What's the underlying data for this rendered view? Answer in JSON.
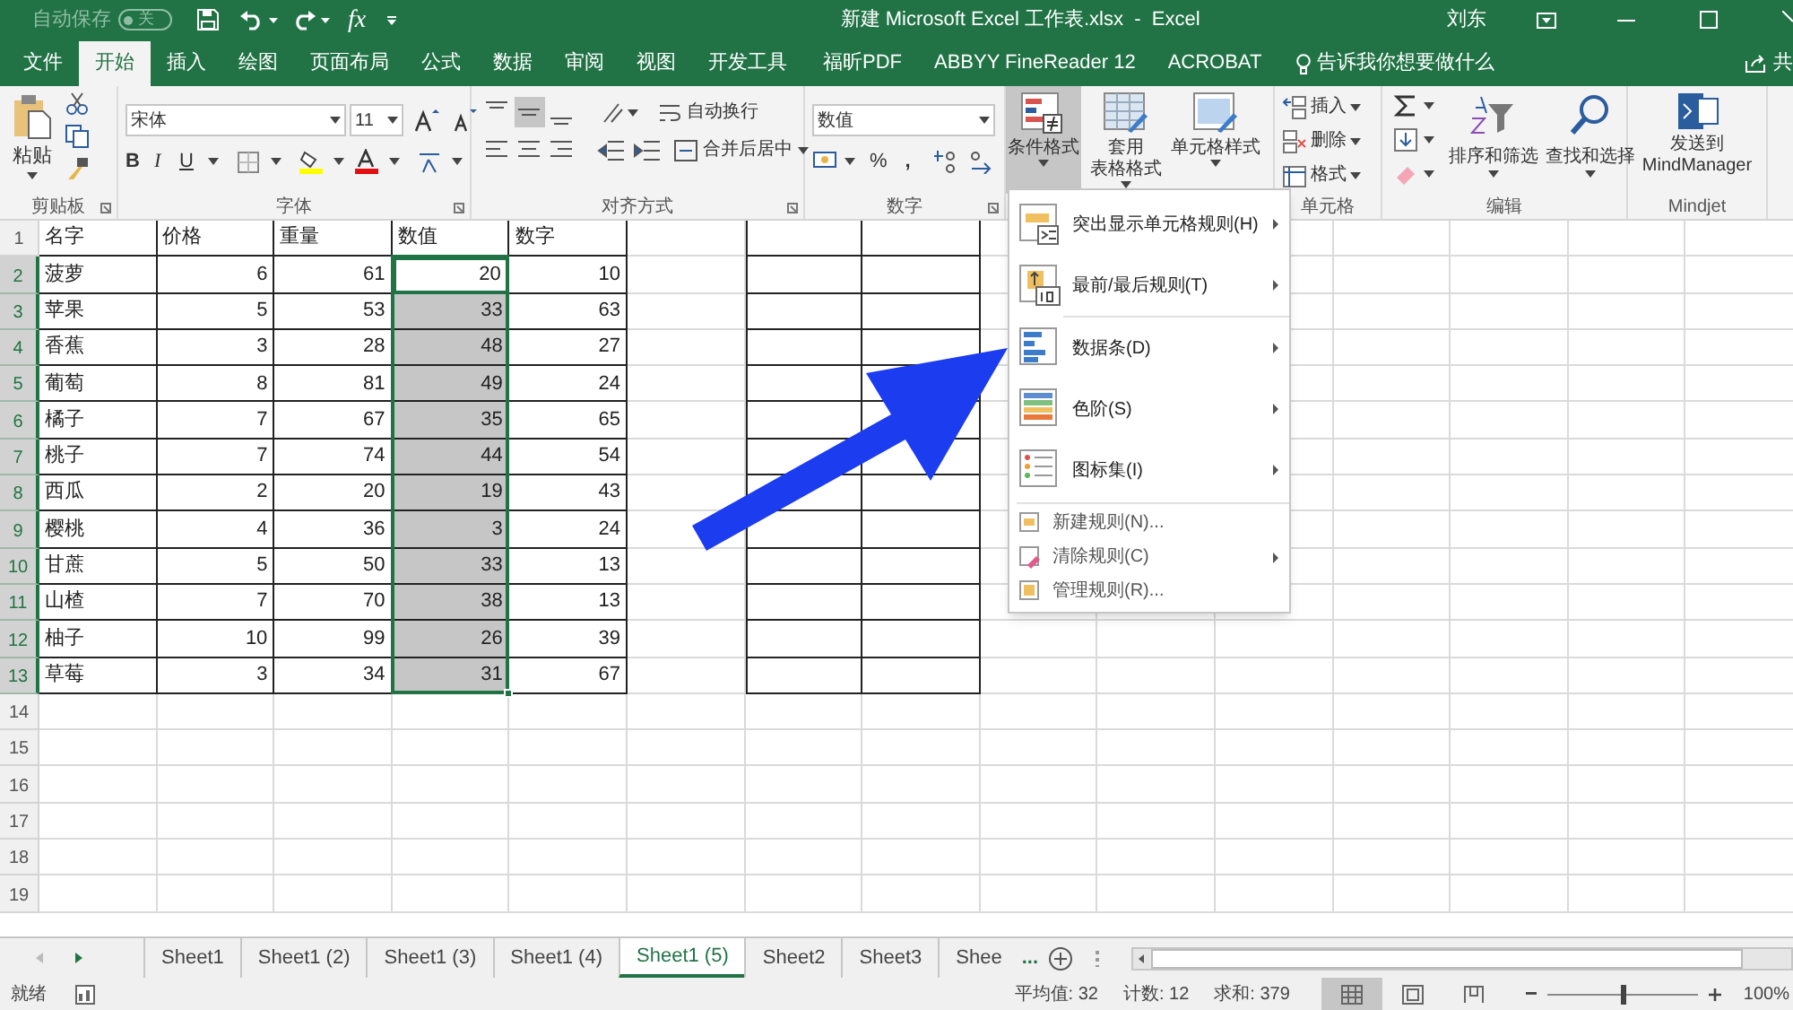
{
  "title_bar": {
    "autosave_label": "自动保存",
    "autosave_state": "关",
    "autosave_on": false,
    "formula_quick": "fx",
    "title": "新建 Microsoft Excel 工作表.xlsx  -  Excel",
    "user": "刘东"
  },
  "menu_tabs": [
    {
      "label": "文件",
      "selected": false
    },
    {
      "label": "开始",
      "selected": true
    },
    {
      "label": "插入",
      "selected": false
    },
    {
      "label": "绘图",
      "selected": false
    },
    {
      "label": "页面布局",
      "selected": false
    },
    {
      "label": "公式",
      "selected": false
    },
    {
      "label": "数据",
      "selected": false
    },
    {
      "label": "审阅",
      "selected": false
    },
    {
      "label": "视图",
      "selected": false
    },
    {
      "label": "开发工具",
      "selected": false
    },
    {
      "label": "福昕PDF",
      "selected": false
    },
    {
      "label": "ABBYY FineReader 12",
      "selected": false
    },
    {
      "label": "ACROBAT",
      "selected": false
    }
  ],
  "tell_me": "告诉我你想要做什么",
  "share": "共",
  "ribbon": {
    "clipboard": {
      "paste": "粘贴",
      "label": "剪贴板"
    },
    "font": {
      "name": "宋体",
      "size": "11",
      "bold": "B",
      "italic": "I",
      "underline": "U",
      "label": "字体"
    },
    "alignment": {
      "vertical_align": [
        {
          "selected": false
        },
        {
          "selected": true
        },
        {
          "selected": false
        }
      ],
      "wrap": "自动换行",
      "merge": "合并后居中",
      "label": "对齐方式"
    },
    "number": {
      "format": "数值",
      "percent": "%",
      "comma": ",",
      "label": "数字"
    },
    "styles": [
      {
        "lines": [
          "条件格式"
        ],
        "expanded": true
      },
      {
        "lines": [
          "套用",
          "表格格式"
        ],
        "expanded": false
      },
      {
        "lines": [
          "单元格样式"
        ],
        "expanded": false
      }
    ],
    "cells": {
      "insert": "插入",
      "delete": "删除",
      "format": "格式",
      "label": "单元格"
    },
    "editing": {
      "sort": "排序和筛选",
      "find": "查找和选择",
      "label": "编辑"
    },
    "mindjet": {
      "send": "发送到\nMindManager",
      "label": "Mindjet"
    }
  },
  "sheet": {
    "rows": [
      {
        "n": "1",
        "cells": [
          {
            "text": "名字",
            "selected": false,
            "active": false
          },
          {
            "text": "价格",
            "selected": false,
            "active": false
          },
          {
            "text": "重量",
            "selected": false,
            "active": false
          },
          {
            "text": "数值",
            "selected": false,
            "active": false
          },
          {
            "text": "数字",
            "selected": false,
            "active": false
          }
        ]
      },
      {
        "n": "2",
        "cells": [
          {
            "text": "菠萝",
            "selected": false,
            "active": false
          },
          {
            "text": "6",
            "selected": false,
            "active": false
          },
          {
            "text": "61",
            "selected": false,
            "active": false
          },
          {
            "text": "20",
            "selected": true,
            "active": true
          },
          {
            "text": "10",
            "selected": false,
            "active": false
          }
        ]
      },
      {
        "n": "3",
        "cells": [
          {
            "text": "苹果",
            "selected": false,
            "active": false
          },
          {
            "text": "5",
            "selected": false,
            "active": false
          },
          {
            "text": "53",
            "selected": false,
            "active": false
          },
          {
            "text": "33",
            "selected": true,
            "active": false
          },
          {
            "text": "63",
            "selected": false,
            "active": false
          }
        ]
      },
      {
        "n": "4",
        "cells": [
          {
            "text": "香蕉",
            "selected": false,
            "active": false
          },
          {
            "text": "3",
            "selected": false,
            "active": false
          },
          {
            "text": "28",
            "selected": false,
            "active": false
          },
          {
            "text": "48",
            "selected": true,
            "active": false
          },
          {
            "text": "27",
            "selected": false,
            "active": false
          }
        ]
      },
      {
        "n": "5",
        "cells": [
          {
            "text": "葡萄",
            "selected": false,
            "active": false
          },
          {
            "text": "8",
            "selected": false,
            "active": false
          },
          {
            "text": "81",
            "selected": false,
            "active": false
          },
          {
            "text": "49",
            "selected": true,
            "active": false
          },
          {
            "text": "24",
            "selected": false,
            "active": false
          }
        ]
      },
      {
        "n": "6",
        "cells": [
          {
            "text": "橘子",
            "selected": false,
            "active": false
          },
          {
            "text": "7",
            "selected": false,
            "active": false
          },
          {
            "text": "67",
            "selected": false,
            "active": false
          },
          {
            "text": "35",
            "selected": true,
            "active": false
          },
          {
            "text": "65",
            "selected": false,
            "active": false
          }
        ]
      },
      {
        "n": "7",
        "cells": [
          {
            "text": "桃子",
            "selected": false,
            "active": false
          },
          {
            "text": "7",
            "selected": false,
            "active": false
          },
          {
            "text": "74",
            "selected": false,
            "active": false
          },
          {
            "text": "44",
            "selected": true,
            "active": false
          },
          {
            "text": "54",
            "selected": false,
            "active": false
          }
        ]
      },
      {
        "n": "8",
        "cells": [
          {
            "text": "西瓜",
            "selected": false,
            "active": false
          },
          {
            "text": "2",
            "selected": false,
            "active": false
          },
          {
            "text": "20",
            "selected": false,
            "active": false
          },
          {
            "text": "19",
            "selected": true,
            "active": false
          },
          {
            "text": "43",
            "selected": false,
            "active": false
          }
        ]
      },
      {
        "n": "9",
        "cells": [
          {
            "text": "樱桃",
            "selected": false,
            "active": false
          },
          {
            "text": "4",
            "selected": false,
            "active": false
          },
          {
            "text": "36",
            "selected": false,
            "active": false
          },
          {
            "text": "3",
            "selected": true,
            "active": false
          },
          {
            "text": "24",
            "selected": false,
            "active": false
          }
        ]
      },
      {
        "n": "10",
        "cells": [
          {
            "text": "甘蔗",
            "selected": false,
            "active": false
          },
          {
            "text": "5",
            "selected": false,
            "active": false
          },
          {
            "text": "50",
            "selected": false,
            "active": false
          },
          {
            "text": "33",
            "selected": true,
            "active": false
          },
          {
            "text": "13",
            "selected": false,
            "active": false
          }
        ]
      },
      {
        "n": "11",
        "cells": [
          {
            "text": "山楂",
            "selected": false,
            "active": false
          },
          {
            "text": "7",
            "selected": false,
            "active": false
          },
          {
            "text": "70",
            "selected": false,
            "active": false
          },
          {
            "text": "38",
            "selected": true,
            "active": false
          },
          {
            "text": "13",
            "selected": false,
            "active": false
          }
        ]
      },
      {
        "n": "12",
        "cells": [
          {
            "text": "柚子",
            "selected": false,
            "active": false
          },
          {
            "text": "10",
            "selected": false,
            "active": false
          },
          {
            "text": "99",
            "selected": false,
            "active": false
          },
          {
            "text": "26",
            "selected": true,
            "active": false
          },
          {
            "text": "39",
            "selected": false,
            "active": false
          }
        ]
      },
      {
        "n": "13",
        "cells": [
          {
            "text": "草莓",
            "selected": false,
            "active": false
          },
          {
            "text": "3",
            "selected": false,
            "active": false
          },
          {
            "text": "34",
            "selected": false,
            "active": false
          },
          {
            "text": "31",
            "selected": true,
            "active": false
          },
          {
            "text": "67",
            "selected": false,
            "active": false
          }
        ]
      },
      {
        "n": "14"
      },
      {
        "n": "15"
      },
      {
        "n": "16"
      },
      {
        "n": "17"
      },
      {
        "n": "18"
      },
      {
        "n": "19"
      }
    ]
  },
  "conditional_menu": [
    {
      "kind": "large",
      "label": "突出显示单元格规则(H)",
      "submenu": true
    },
    {
      "kind": "large",
      "label": "最前/最后规则(T)",
      "submenu": true
    },
    {
      "kind": "large",
      "label": "数据条(D)",
      "submenu": true
    },
    {
      "kind": "large",
      "label": "色阶(S)",
      "submenu": true
    },
    {
      "kind": "large",
      "label": "图标集(I)",
      "submenu": true
    },
    {
      "kind": "small",
      "label": "新建规则(N)...",
      "submenu": false
    },
    {
      "kind": "small",
      "label": "清除规则(C)",
      "submenu": true
    },
    {
      "kind": "small",
      "label": "管理规则(R)...",
      "submenu": false
    }
  ],
  "sheet_tabs": [
    {
      "label": "Sheet1",
      "selected": false
    },
    {
      "label": "Sheet1 (2)",
      "selected": false
    },
    {
      "label": "Sheet1 (3)",
      "selected": false
    },
    {
      "label": "Sheet1 (4)",
      "selected": false
    },
    {
      "label": "Sheet1 (5)",
      "selected": true
    },
    {
      "label": "Sheet2",
      "selected": false
    },
    {
      "label": "Sheet3",
      "selected": false
    },
    {
      "label": "Shee",
      "selected": false
    }
  ],
  "more_tabs": "...",
  "status_bar": {
    "mode": "就绪",
    "average": "平均值: 32",
    "count": "计数: 12",
    "sum": "求和: 379",
    "views": [
      {
        "selected": true
      },
      {
        "selected": false
      },
      {
        "selected": false
      }
    ],
    "zoom_slider": {
      "level": 0.5
    },
    "zoom": "100%"
  }
}
